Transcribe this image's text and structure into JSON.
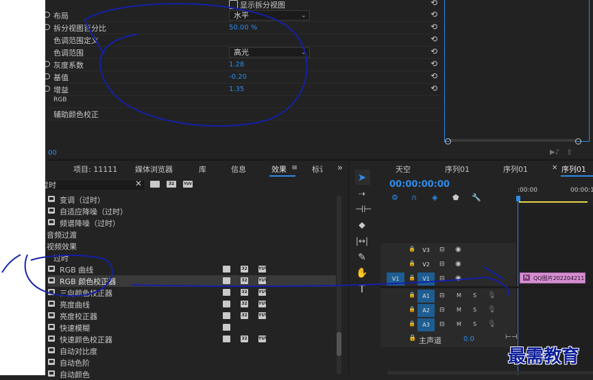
{
  "effect_controls": {
    "split_view_checkbox": "显示拆分视图",
    "params": [
      {
        "label": "布局",
        "value": "水平",
        "type": "dropdown"
      },
      {
        "label": "拆分视图百分比",
        "value": "50.00 %",
        "type": "number"
      },
      {
        "label": "色调范围定义",
        "value": "",
        "type": "header"
      },
      {
        "label": "色调范围",
        "value": "高光",
        "type": "dropdown"
      },
      {
        "label": "灰度系数",
        "value": "1.28",
        "type": "number"
      },
      {
        "label": "基值",
        "value": "-0.20",
        "type": "number"
      },
      {
        "label": "增益",
        "value": "1.35",
        "type": "number"
      },
      {
        "label": "RGB",
        "value": "",
        "type": "header"
      },
      {
        "label": "辅助颜色校正",
        "value": "",
        "type": "header"
      }
    ],
    "time_fragment": "00"
  },
  "project_panel": {
    "tabs": [
      "项目: 11111",
      "媒体浏览器",
      "库",
      "信息",
      "效果",
      "标记"
    ],
    "active_tab": "效果",
    "search_value": "过时",
    "more": "»",
    "effects_tree": [
      {
        "label": "变调（过时）",
        "indent": 1,
        "folder": false
      },
      {
        "label": "自适应降噪（过时）",
        "indent": 1,
        "folder": false
      },
      {
        "label": "频谱降噪（过时）",
        "indent": 1,
        "folder": false
      },
      {
        "label": "音频过渡",
        "indent": 0,
        "folder": true
      },
      {
        "label": "视频效果",
        "indent": 0,
        "folder": true
      },
      {
        "label": "过时",
        "indent": 0,
        "folder": true
      },
      {
        "label": "RGB 曲线",
        "indent": 1,
        "badges": 3
      },
      {
        "label": "RGB 颜色校正器",
        "indent": 1,
        "badges": 3,
        "selected": true
      },
      {
        "label": "三向颜色校正器",
        "indent": 1,
        "badges": 3
      },
      {
        "label": "亮度曲线",
        "indent": 1,
        "badges": 3
      },
      {
        "label": "亮度校正器",
        "indent": 1,
        "badges": 3
      },
      {
        "label": "快速模糊",
        "indent": 1,
        "badges": 1
      },
      {
        "label": "快速颜色校正器",
        "indent": 1,
        "badges": 3
      },
      {
        "label": "自动对比度",
        "indent": 1,
        "badges": 0
      },
      {
        "label": "自动色阶",
        "indent": 1,
        "badges": 0
      },
      {
        "label": "自动颜色",
        "indent": 1,
        "badges": 0
      }
    ],
    "badge_labels": [
      "32",
      "YUV"
    ]
  },
  "timeline": {
    "tabs": [
      "天空",
      "序列01",
      "序列01",
      "序列01"
    ],
    "active_tab": "序列01",
    "timecode": "00:00:00:00",
    "ruler": [
      ":00:00",
      "00:00:1"
    ],
    "tracks": [
      {
        "name": "V3",
        "kind": "video"
      },
      {
        "name": "V2",
        "kind": "video"
      },
      {
        "name": "V1",
        "kind": "video",
        "source": "V1"
      },
      {
        "name": "A1",
        "kind": "audio"
      },
      {
        "name": "A2",
        "kind": "audio"
      },
      {
        "name": "A3",
        "kind": "audio"
      }
    ],
    "master": {
      "label": "主声道",
      "value": "0.0"
    },
    "track_buttons": {
      "mute": "M",
      "solo": "S"
    },
    "clip_label": "QQ图片202204211",
    "clip_fx": "fx"
  },
  "watermark": "最需教育",
  "colors": {
    "accent": "#2d8ceb",
    "playhead": "#3b7ddd",
    "clip": "#d58fd0",
    "track_selected": "#1d5d92",
    "annotation": "#1420a8"
  }
}
